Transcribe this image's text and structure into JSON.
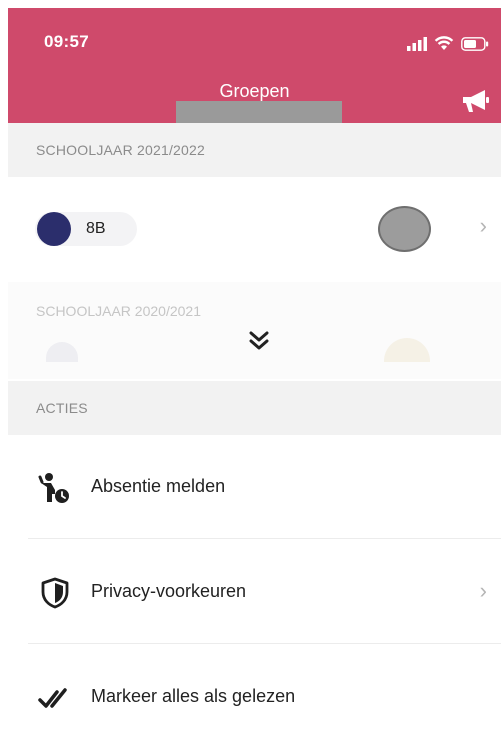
{
  "status_bar": {
    "time": "09:57"
  },
  "header": {
    "title": "Groepen",
    "accent": "#cf4a6b"
  },
  "sections": {
    "current_year": "SCHOOLJAAR 2021/2022",
    "previous_year": "SCHOOLJAAR 2020/2021",
    "actions": "ACTIES"
  },
  "group": {
    "label": "8B",
    "color": "#2b2e6c"
  },
  "actions": [
    {
      "label": "Absentie melden",
      "icon": "absence-icon",
      "has_chevron": false
    },
    {
      "label": "Privacy-voorkeuren",
      "icon": "shield-icon",
      "has_chevron": true
    },
    {
      "label": "Markeer alles als gelezen",
      "icon": "double-check-icon",
      "has_chevron": false
    }
  ],
  "chevron_glyph": "›"
}
